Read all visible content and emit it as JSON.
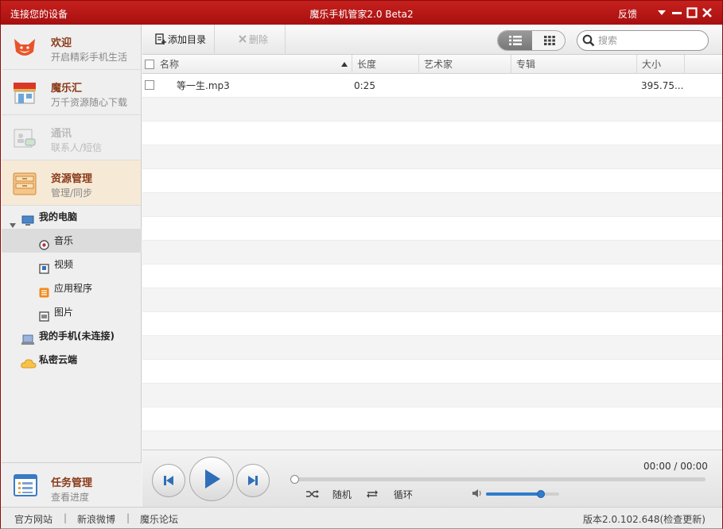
{
  "titlebar": {
    "left_title": "连接您的设备",
    "center_title": "魔乐手机管家2.0 Beta2",
    "feedback": "反馈"
  },
  "sidebar": {
    "nav": [
      {
        "title": "欢迎",
        "subtitle": "开启精彩手机生活",
        "icon": "fox-logo-icon"
      },
      {
        "title": "魔乐汇",
        "subtitle": "万千资源随心下载",
        "icon": "store-icon"
      },
      {
        "title": "通讯",
        "subtitle": "联系人/短信",
        "icon": "contacts-icon"
      },
      {
        "title": "资源管理",
        "subtitle": "管理/同步",
        "icon": "drawer-icon"
      }
    ],
    "tree": {
      "my_pc": "我的电脑",
      "music": "音乐",
      "video": "视频",
      "apps": "应用程序",
      "pictures": "图片",
      "my_phone": "我的手机(未连接)",
      "cloud": "私密云端"
    },
    "task": {
      "title": "任务管理",
      "subtitle": "查看进度"
    }
  },
  "toolbar": {
    "add_label": "添加目录",
    "delete_label": "删除",
    "search_placeholder": "搜索"
  },
  "table": {
    "columns": [
      "名称",
      "长度",
      "艺术家",
      "专辑",
      "大小"
    ],
    "rows": [
      {
        "name": "等一生.mp3",
        "length": "0:25",
        "artist": "",
        "album": "",
        "size": "395.75..."
      }
    ]
  },
  "player": {
    "time": "00:00 / 00:00",
    "progress": 0,
    "shuffle_label": "随机",
    "repeat_label": "循环",
    "volume": 0.75
  },
  "statusbar": {
    "links": [
      "官方网站",
      "新浪微博",
      "魔乐论坛"
    ],
    "version": "版本2.0.102.648(检查更新)"
  },
  "colors": {
    "titlebar": "#b01515",
    "accent_blue": "#2f7ccc",
    "nav_title": "#8a3a1a"
  }
}
